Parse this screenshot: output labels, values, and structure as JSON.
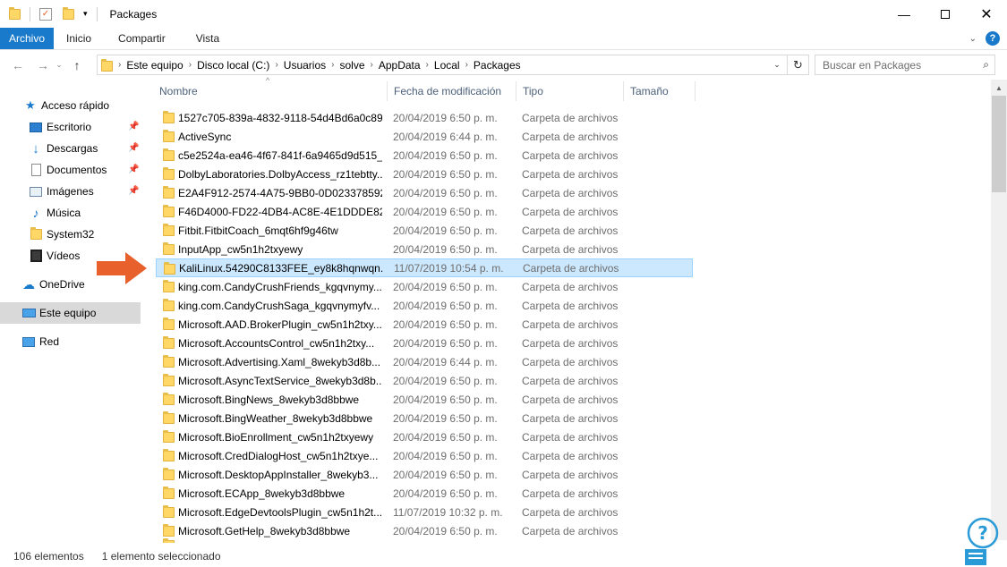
{
  "window": {
    "title": "Packages",
    "minimize_icon": "minimize-icon",
    "maximize_icon": "maximize-icon",
    "close_icon": "close-icon"
  },
  "ribbon": {
    "tabs": [
      "Archivo",
      "Inicio",
      "Compartir",
      "Vista"
    ],
    "help": "?"
  },
  "address": {
    "crumbs": [
      "Este equipo",
      "Disco local (C:)",
      "Usuarios",
      "solve",
      "AppData",
      "Local",
      "Packages"
    ],
    "search_placeholder": "Buscar en Packages"
  },
  "nav": {
    "quick_access": "Acceso rápido",
    "items": [
      {
        "label": "Escritorio",
        "icon": "desktop-icon",
        "pinned": true
      },
      {
        "label": "Descargas",
        "icon": "download-icon",
        "pinned": true
      },
      {
        "label": "Documentos",
        "icon": "documents-icon",
        "pinned": true
      },
      {
        "label": "Imágenes",
        "icon": "pictures-icon",
        "pinned": true
      },
      {
        "label": "Música",
        "icon": "music-icon",
        "pinned": false
      },
      {
        "label": "System32",
        "icon": "folder-icon",
        "pinned": false
      },
      {
        "label": "Vídeos",
        "icon": "videos-icon",
        "pinned": false
      }
    ],
    "onedrive": "OneDrive",
    "this_pc": "Este equipo",
    "network": "Red"
  },
  "columns": {
    "name": "Nombre",
    "date": "Fecha de modificación",
    "type": "Tipo",
    "size": "Tamaño"
  },
  "files": [
    {
      "name": "1527c705-839a-4832-9118-54d4Bd6a0c89...",
      "date": "20/04/2019 6:50 p. m.",
      "type": "Carpeta de archivos"
    },
    {
      "name": "ActiveSync",
      "date": "20/04/2019 6:44 p. m.",
      "type": "Carpeta de archivos"
    },
    {
      "name": "c5e2524a-ea46-4f67-841f-6a9465d9d515_...",
      "date": "20/04/2019 6:50 p. m.",
      "type": "Carpeta de archivos"
    },
    {
      "name": "DolbyLaboratories.DolbyAccess_rz1tebtty...",
      "date": "20/04/2019 6:50 p. m.",
      "type": "Carpeta de archivos"
    },
    {
      "name": "E2A4F912-2574-4A75-9BB0-0D023378592...",
      "date": "20/04/2019 6:50 p. m.",
      "type": "Carpeta de archivos"
    },
    {
      "name": "F46D4000-FD22-4DB4-AC8E-4E1DDDE828...",
      "date": "20/04/2019 6:50 p. m.",
      "type": "Carpeta de archivos"
    },
    {
      "name": "Fitbit.FitbitCoach_6mqt6hf9g46tw",
      "date": "20/04/2019 6:50 p. m.",
      "type": "Carpeta de archivos"
    },
    {
      "name": "InputApp_cw5n1h2txyewy",
      "date": "20/04/2019 6:50 p. m.",
      "type": "Carpeta de archivos"
    },
    {
      "name": "KaliLinux.54290C8133FEE_ey8k8hqnwqn...",
      "date": "11/07/2019 10:54 p. m.",
      "type": "Carpeta de archivos",
      "selected": true
    },
    {
      "name": "king.com.CandyCrushFriends_kgqvnymy...",
      "date": "20/04/2019 6:50 p. m.",
      "type": "Carpeta de archivos"
    },
    {
      "name": "king.com.CandyCrushSaga_kgqvnymyfv...",
      "date": "20/04/2019 6:50 p. m.",
      "type": "Carpeta de archivos"
    },
    {
      "name": "Microsoft.AAD.BrokerPlugin_cw5n1h2txy...",
      "date": "20/04/2019 6:50 p. m.",
      "type": "Carpeta de archivos"
    },
    {
      "name": "Microsoft.AccountsControl_cw5n1h2txy...",
      "date": "20/04/2019 6:50 p. m.",
      "type": "Carpeta de archivos"
    },
    {
      "name": "Microsoft.Advertising.Xaml_8wekyb3d8b...",
      "date": "20/04/2019 6:44 p. m.",
      "type": "Carpeta de archivos"
    },
    {
      "name": "Microsoft.AsyncTextService_8wekyb3d8b...",
      "date": "20/04/2019 6:50 p. m.",
      "type": "Carpeta de archivos"
    },
    {
      "name": "Microsoft.BingNews_8wekyb3d8bbwe",
      "date": "20/04/2019 6:50 p. m.",
      "type": "Carpeta de archivos"
    },
    {
      "name": "Microsoft.BingWeather_8wekyb3d8bbwe",
      "date": "20/04/2019 6:50 p. m.",
      "type": "Carpeta de archivos"
    },
    {
      "name": "Microsoft.BioEnrollment_cw5n1h2txyewy",
      "date": "20/04/2019 6:50 p. m.",
      "type": "Carpeta de archivos"
    },
    {
      "name": "Microsoft.CredDialogHost_cw5n1h2txye...",
      "date": "20/04/2019 6:50 p. m.",
      "type": "Carpeta de archivos"
    },
    {
      "name": "Microsoft.DesktopAppInstaller_8wekyb3...",
      "date": "20/04/2019 6:50 p. m.",
      "type": "Carpeta de archivos"
    },
    {
      "name": "Microsoft.ECApp_8wekyb3d8bbwe",
      "date": "20/04/2019 6:50 p. m.",
      "type": "Carpeta de archivos"
    },
    {
      "name": "Microsoft.EdgeDevtoolsPlugin_cw5n1h2t...",
      "date": "11/07/2019 10:32 p. m.",
      "type": "Carpeta de archivos"
    },
    {
      "name": "Microsoft.GetHelp_8wekyb3d8bbwe",
      "date": "20/04/2019 6:50 p. m.",
      "type": "Carpeta de archivos"
    },
    {
      "name": "",
      "date": "",
      "type": ""
    }
  ],
  "status": {
    "count": "106 elementos",
    "selection": "1 elemento seleccionado"
  },
  "colors": {
    "accent": "#1979ca",
    "selection_bg": "#cce8ff",
    "selection_border": "#99d1ff",
    "arrow": "#e8602c"
  }
}
